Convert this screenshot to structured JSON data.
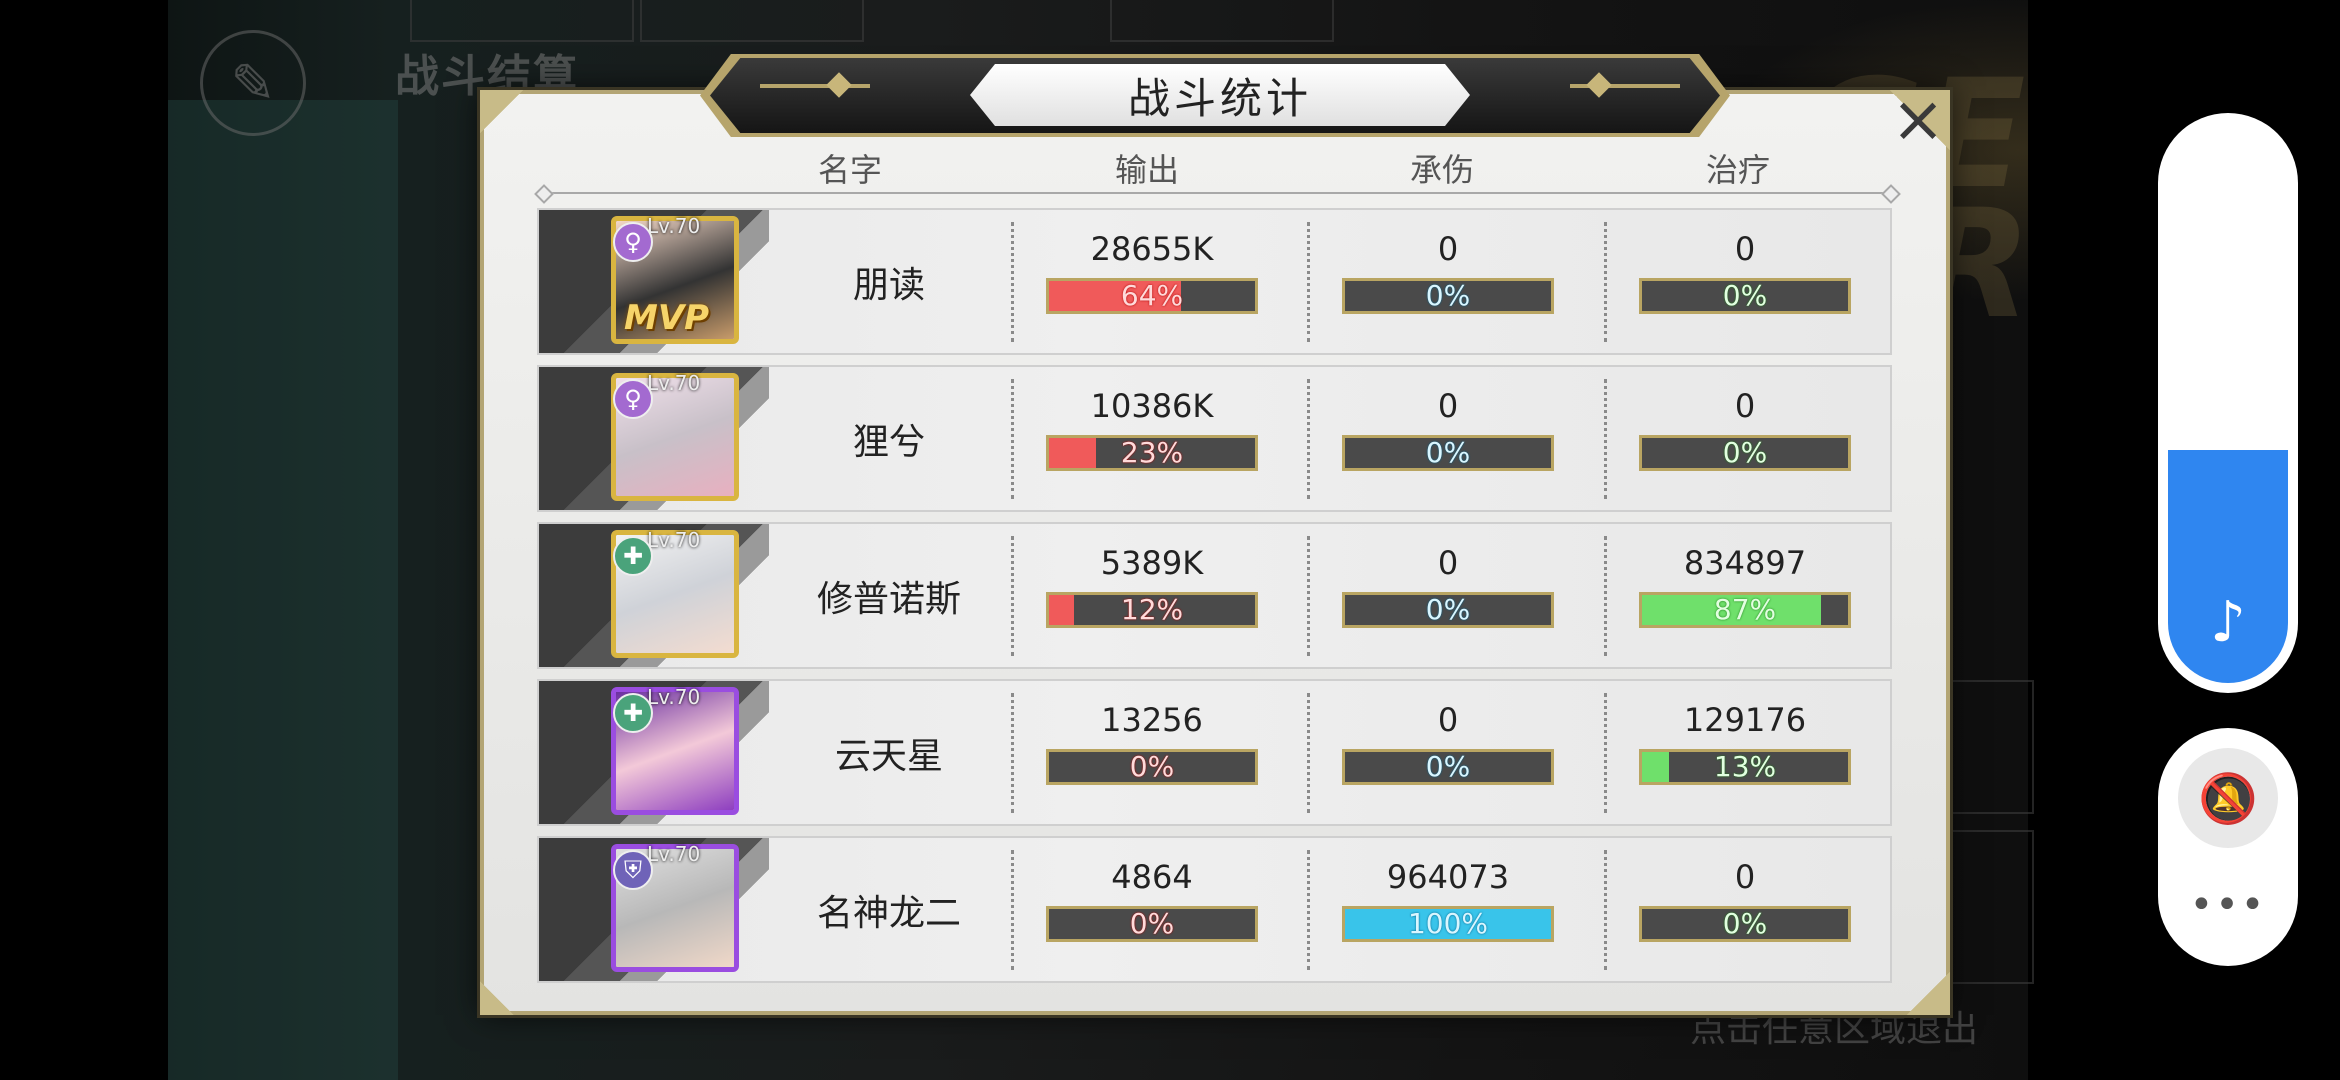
{
  "background": {
    "section_title": "战斗结算",
    "hint": "点击任意区域退出"
  },
  "dialog": {
    "title": "战斗统计",
    "close_label": "×",
    "headers": {
      "name": "名字",
      "output": "输出",
      "damage_taken": "承伤",
      "healing": "治疗"
    }
  },
  "players": [
    {
      "name": "朋读",
      "level": "Lv.70",
      "role": "mage",
      "frame": "gold",
      "mvp": "MVP",
      "output": {
        "value": "28655K",
        "percent_label": "64%",
        "percent": 64
      },
      "damage_taken": {
        "value": "0",
        "percent_label": "0%",
        "percent": 0
      },
      "healing": {
        "value": "0",
        "percent_label": "0%",
        "percent": 0
      }
    },
    {
      "name": "狸兮",
      "level": "Lv.70",
      "role": "mage",
      "frame": "gold",
      "output": {
        "value": "10386K",
        "percent_label": "23%",
        "percent": 23
      },
      "damage_taken": {
        "value": "0",
        "percent_label": "0%",
        "percent": 0
      },
      "healing": {
        "value": "0",
        "percent_label": "0%",
        "percent": 0
      }
    },
    {
      "name": "修普诺斯",
      "level": "Lv.70",
      "role": "healer",
      "frame": "gold",
      "output": {
        "value": "5389K",
        "percent_label": "12%",
        "percent": 12
      },
      "damage_taken": {
        "value": "0",
        "percent_label": "0%",
        "percent": 0
      },
      "healing": {
        "value": "834897",
        "percent_label": "87%",
        "percent": 87
      }
    },
    {
      "name": "云天星",
      "level": "Lv.70",
      "role": "healer",
      "frame": "purple",
      "output": {
        "value": "13256",
        "percent_label": "0%",
        "percent": 0
      },
      "damage_taken": {
        "value": "0",
        "percent_label": "0%",
        "percent": 0
      },
      "healing": {
        "value": "129176",
        "percent_label": "13%",
        "percent": 13
      }
    },
    {
      "name": "名神龙二",
      "level": "Lv.70",
      "role": "tank",
      "frame": "purple",
      "output": {
        "value": "4864",
        "percent_label": "0%",
        "percent": 0
      },
      "damage_taken": {
        "value": "964073",
        "percent_label": "100%",
        "percent": 100
      },
      "healing": {
        "value": "0",
        "percent_label": "0%",
        "percent": 0
      }
    }
  ],
  "colors": {
    "output_bar": "#f05a5a",
    "damage_taken_bar": "#39c4ea",
    "healing_bar": "#6fe06b",
    "frame_gold": "#d9b540",
    "frame_purple": "#9a4de0",
    "float_accent": "#2f86f0"
  },
  "side_controls": {
    "volume_level": 0.42,
    "music_icon": "music-note-icon",
    "mute_icon": "bell-muted-icon",
    "more_icon": "more-dots-icon"
  }
}
